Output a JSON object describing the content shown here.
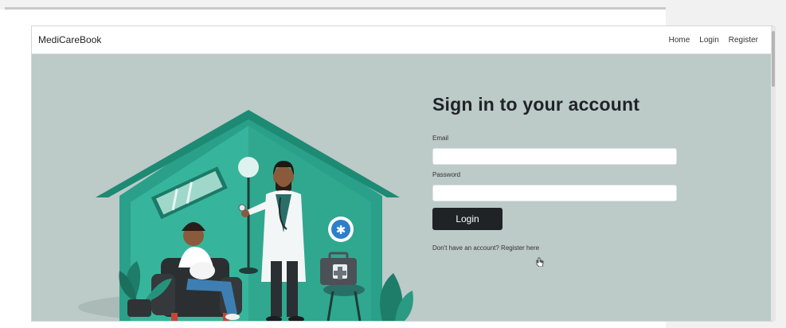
{
  "navbar": {
    "brand": "MediCareBook",
    "links": [
      {
        "label": "Home"
      },
      {
        "label": "Login"
      },
      {
        "label": "Register"
      }
    ]
  },
  "form": {
    "title": "Sign in to your account",
    "email_label": "Email",
    "email_value": "",
    "password_label": "Password",
    "password_value": "",
    "login_button": "Login",
    "register_prompt": "Don't have an account?",
    "register_link": "Register here"
  },
  "colors": {
    "hero_bg": "#bccac8",
    "house": "#1f8f7a",
    "button": "#1f2326"
  },
  "icons": [
    "stethoscope",
    "medical-star-icon",
    "first-aid-kit-icon",
    "cursor-icon"
  ]
}
